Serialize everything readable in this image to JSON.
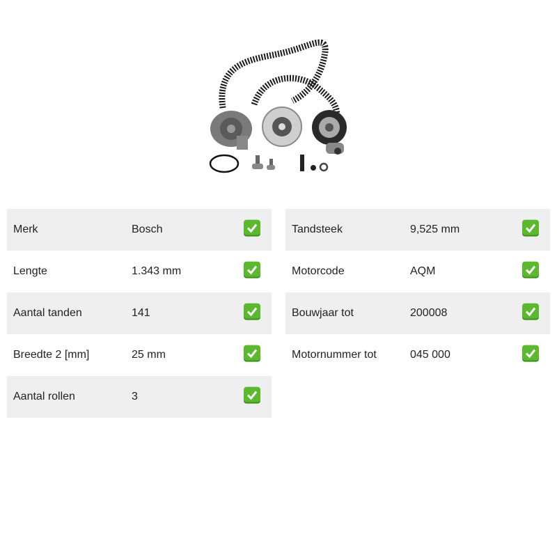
{
  "product": {
    "image_icon": "timing-belt-kit-with-water-pump"
  },
  "specs_left": [
    {
      "label": "Merk",
      "value": "Bosch",
      "checked": true
    },
    {
      "label": "Lengte",
      "value": "1.343 mm",
      "checked": true
    },
    {
      "label": "Aantal tanden",
      "value": "141",
      "checked": true
    },
    {
      "label": "Breedte 2 [mm]",
      "value": "25 mm",
      "checked": true
    },
    {
      "label": "Aantal rollen",
      "value": "3",
      "checked": true
    }
  ],
  "specs_right": [
    {
      "label": "Tandsteek",
      "value": "9,525 mm",
      "checked": true
    },
    {
      "label": "Motorcode",
      "value": "AQM",
      "checked": true
    },
    {
      "label": "Bouwjaar tot",
      "value": "200008",
      "checked": true
    },
    {
      "label": "Motornummer tot",
      "value": "045 000",
      "checked": true
    }
  ],
  "colors": {
    "row_shade": "#efefef",
    "check_green": "#5cb82e"
  }
}
